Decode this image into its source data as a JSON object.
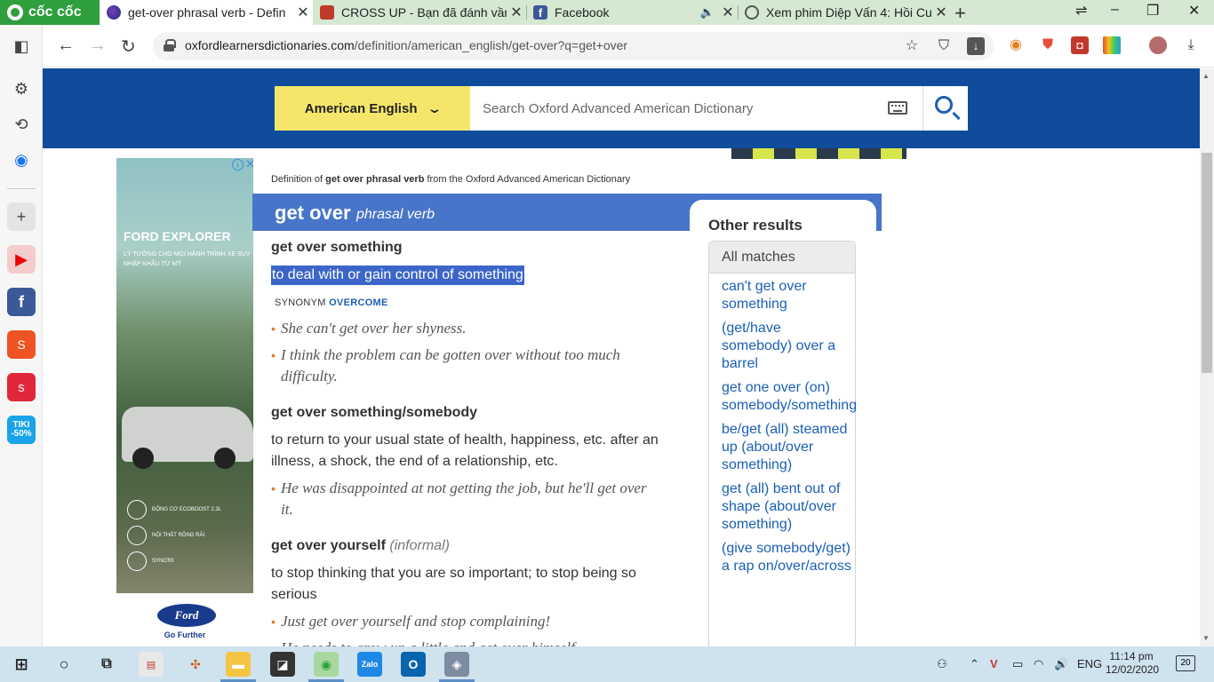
{
  "browser": {
    "brand": "cốc cốc",
    "tabs": [
      {
        "title": "get-over phrasal verb - Defin",
        "active": true
      },
      {
        "title": "CROSS UP - Bạn đã đánh vần",
        "active": false
      },
      {
        "title": "Facebook",
        "active": false
      },
      {
        "title": "Xem phim Diệp Vấn 4: Hồi Cu",
        "active": false
      }
    ],
    "url_domain": "oxfordlearnersdictionaries.com",
    "url_path": "/definition/american_english/get-over?q=get+over"
  },
  "oxford": {
    "language": "American English",
    "search_placeholder": "Search Oxford Advanced American Dictionary",
    "source_prefix": "Definition of ",
    "source_bold": "get over phrasal verb",
    "source_suffix": " from the Oxford Advanced American Dictionary",
    "headword": "get over",
    "pos": "phrasal verb"
  },
  "ad": {
    "headline": "FORD EXPLORER",
    "subline": "LÝ TƯỞNG CHO MỌI HÀNH TRÌNH XE SUV NHẬP KHẨU TỪ MỸ",
    "features": [
      "ĐỘNG CƠ ECOBOOST 2.3L",
      "NỘI THẤT RỘNG RÃI",
      "SYNC®3"
    ],
    "logo": "Ford",
    "tagline": "Go Further"
  },
  "entry": {
    "senses": [
      {
        "phrase": "get over something",
        "definition": "to deal with or gain control of something",
        "synonym_label": "SYNONYM",
        "synonym": "OVERCOME",
        "examples": [
          "She can't get over her shyness.",
          "I think the problem can be gotten over without too much difficulty."
        ]
      },
      {
        "phrase": "get over something/somebody",
        "definition": "to return to your usual state of health, happiness, etc. after an illness, a shock, the end of a relationship, etc.",
        "examples": [
          "He was disappointed at not getting the job, but he'll get over it."
        ]
      },
      {
        "phrase": "get over yourself",
        "register": "informal",
        "definition": "to stop thinking that you are so important; to stop being so serious",
        "examples": [
          "Just get over yourself and stop complaining!",
          "He needs to grow up a little and get over himself."
        ]
      }
    ]
  },
  "other_results": {
    "heading": "Other results",
    "tab": "All matches",
    "items": [
      "can't get over something",
      "(get/have somebody) over a barrel",
      "get one over (on) somebody/something",
      "be/get (all) steamed up (about/over something)",
      "get (all) bent out of shape (about/over something)",
      "(give somebody/get) a rap on/over/across"
    ]
  },
  "taskbar": {
    "lang": "ENG",
    "time": "11:14 pm",
    "date": "12/02/2020",
    "notifications": "20"
  }
}
